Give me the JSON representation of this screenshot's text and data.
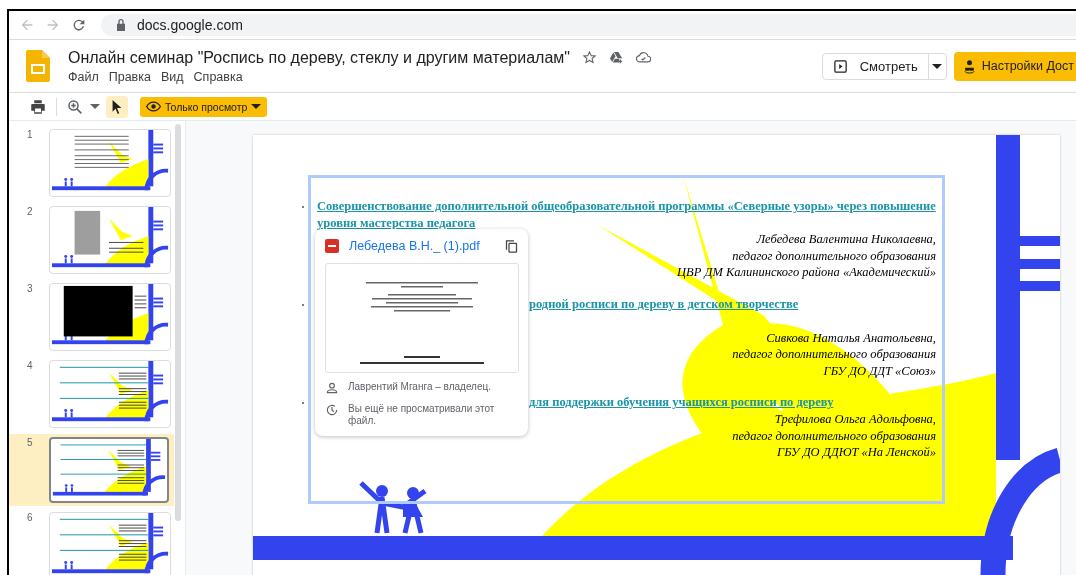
{
  "browser": {
    "url": "docs.google.com"
  },
  "app": {
    "title": "Онлайн семинар \"Роспись по дереву, стеклу и другим материалам\"",
    "menu": [
      "Файл",
      "Правка",
      "Вид",
      "Справка"
    ],
    "view_button": "Смотреть",
    "access_button": "Настройки Дост"
  },
  "toolbar": {
    "mode_button": "Только просмотр"
  },
  "filmstrip": [
    {
      "number": "1",
      "kind": "text",
      "selected": false
    },
    {
      "number": "2",
      "kind": "photo",
      "selected": false
    },
    {
      "number": "3",
      "kind": "video",
      "selected": false
    },
    {
      "number": "4",
      "kind": "links",
      "selected": false
    },
    {
      "number": "5",
      "kind": "links",
      "selected": true
    },
    {
      "number": "6",
      "kind": "links",
      "selected": false
    }
  ],
  "slide": {
    "items": [
      {
        "link": "Совершенствование дополнительной общеобразовательной программы «Северные узоры» через повышение уровня мастерства педагога",
        "author": [
          "Лебедева Валентина Николаевна,",
          "педагог дополнительного образования",
          "ЦВР ДМ Калининского района «Академический»"
        ]
      },
      {
        "link": "родной росписи по дереву в детском творчестве",
        "author": [
          "Сивкова Наталья Анатольевна,",
          "педагог дополнительного образования",
          "ГБУ ДО ДДТ «Союз»"
        ]
      },
      {
        "link": "для поддержки обучения учащихся росписи по дереву",
        "author": [
          "Трефилова Ольга Адольфовна,",
          "педагог дополнительного образования",
          "ГБУ ДО ДДЮТ «На Ленской»"
        ]
      }
    ]
  },
  "file_popup": {
    "file_name": "Лебедева В.Н._ (1).pdf",
    "owner": "Лаврентий Мганга – владелец.",
    "activity": "Вы ещё не просматривали этот файл."
  }
}
